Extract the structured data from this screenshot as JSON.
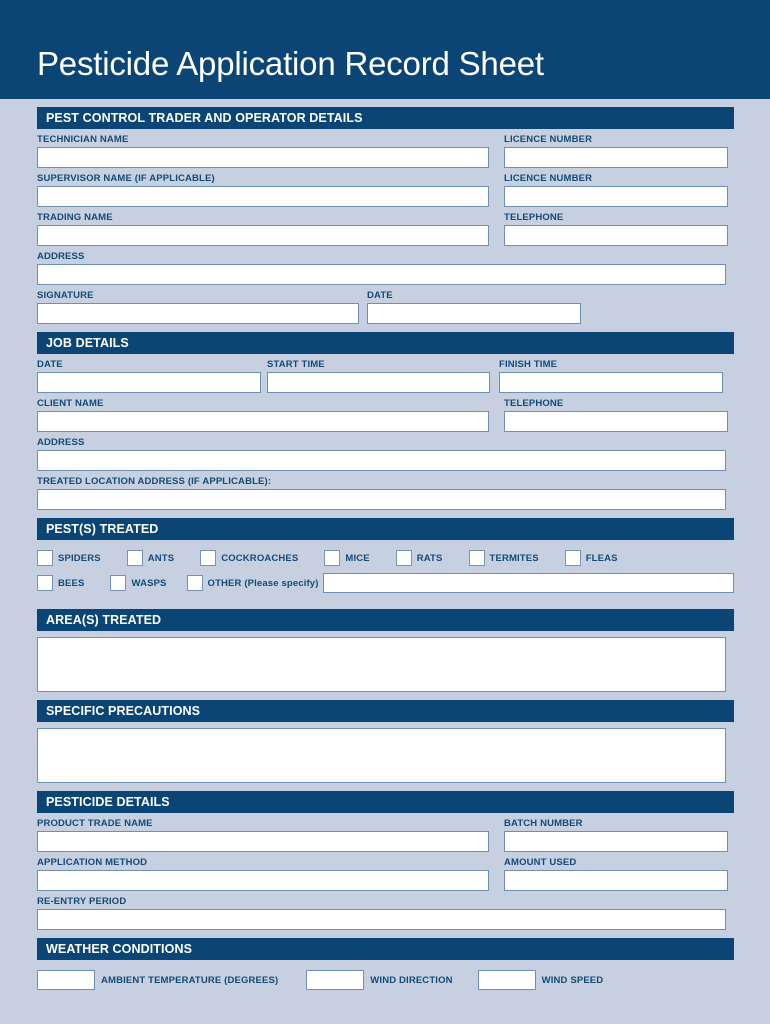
{
  "document": {
    "title": "Pesticide Application Record Sheet"
  },
  "colors": {
    "navy": "#0a4575",
    "page_background": "#c6d0e0",
    "label_text": "#134a77",
    "field_border": "#6f8fb4",
    "field_fill": "#ffffff"
  },
  "sections": {
    "trader": {
      "heading": "PEST CONTROL TRADER AND OPERATOR DETAILS",
      "technician_name": "TECHNICIAN NAME",
      "licence_number_1": "LICENCE NUMBER",
      "supervisor_name": "SUPERVISOR NAME (IF APPLICABLE)",
      "licence_number_2": "LICENCE NUMBER",
      "trading_name": "TRADING NAME",
      "telephone": "TELEPHONE",
      "address": "ADDRESS",
      "signature": "SIGNATURE",
      "date": "DATE"
    },
    "job": {
      "heading": "JOB DETAILS",
      "date": "DATE",
      "start_time": "START TIME",
      "finish_time": "FINISH TIME",
      "client_name": "CLIENT NAME",
      "telephone": "TELEPHONE",
      "address": "ADDRESS",
      "treated_location": "TREATED LOCATION ADDRESS (IF APPLICABLE):"
    },
    "pests": {
      "heading": "PEST(S) TREATED",
      "row1": [
        "SPIDERS",
        "ANTS",
        "COCKROACHES",
        "MICE",
        "RATS",
        "TERMITES",
        "FLEAS"
      ],
      "row2": [
        "BEES",
        "WASPS"
      ],
      "other_label": "OTHER (Please specify)"
    },
    "areas": {
      "heading": "AREA(S) TREATED"
    },
    "precautions": {
      "heading": "SPECIFIC PRECAUTIONS"
    },
    "pesticide": {
      "heading": "PESTICIDE DETAILS",
      "product_trade_name": "PRODUCT TRADE NAME",
      "batch_number": "BATCH NUMBER",
      "application_method": "APPLICATION METHOD",
      "amount_used": "AMOUNT USED",
      "re_entry_period": "RE-ENTRY PERIOD"
    },
    "weather": {
      "heading": "WEATHER CONDITIONS",
      "ambient_temperature": "AMBIENT TEMPERATURE (DEGREES)",
      "wind_direction": "WIND DIRECTION",
      "wind_speed": "WIND SPEED"
    }
  }
}
